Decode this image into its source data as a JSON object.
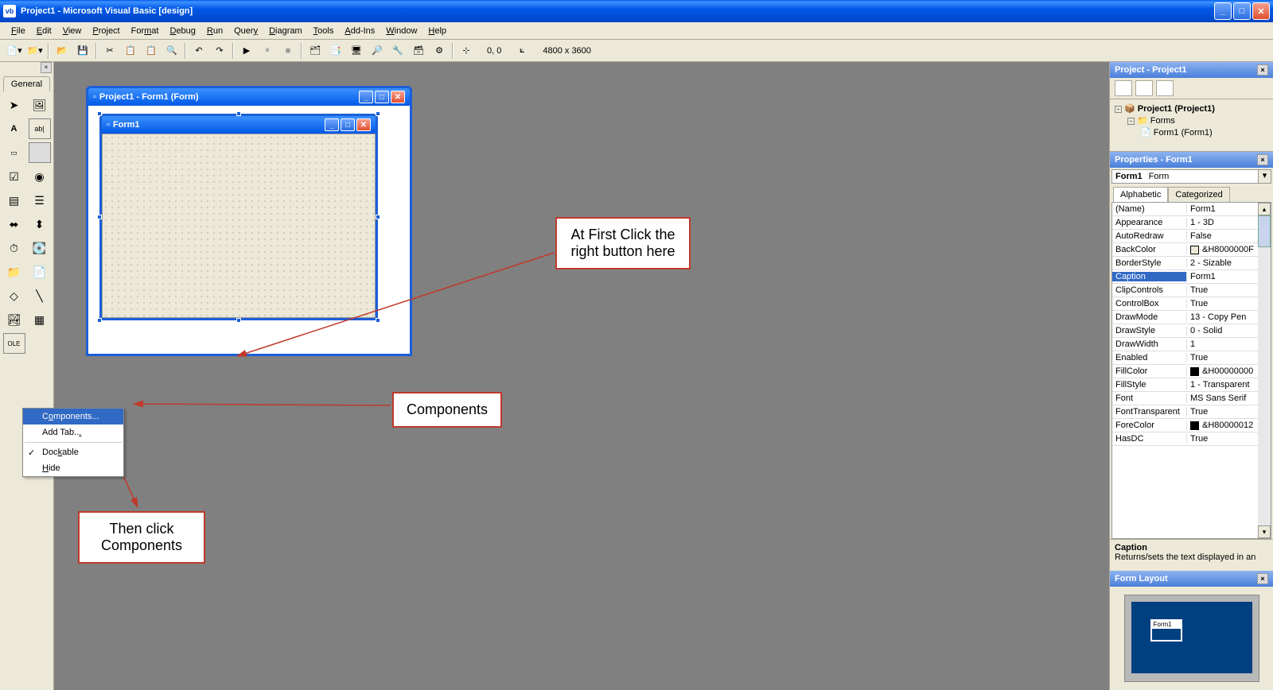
{
  "title": "Project1 - Microsoft Visual Basic [design]",
  "menu": [
    "File",
    "Edit",
    "View",
    "Project",
    "Format",
    "Debug",
    "Run",
    "Query",
    "Diagram",
    "Tools",
    "Add-Ins",
    "Window",
    "Help"
  ],
  "menuUnderline": [
    0,
    0,
    0,
    0,
    3,
    0,
    0,
    4,
    0,
    0,
    0,
    0,
    0
  ],
  "coords": "0, 0",
  "dims": "4800 x 3600",
  "toolbox": {
    "tab": "General"
  },
  "formDesigner": {
    "title": "Project1 - Form1 (Form)",
    "innerTitle": "Form1"
  },
  "contextMenu": {
    "items": [
      "Components...",
      "Add Tab...",
      "Dockable",
      "Hide"
    ],
    "itemsUnderline": [
      1,
      9,
      3,
      0
    ]
  },
  "callouts": {
    "first": "At First Click the right button here",
    "comp": "Components",
    "then": "Then click Components"
  },
  "projectPanel": {
    "title": "Project - Project1",
    "root": "Project1 (Project1)",
    "folder": "Forms",
    "form": "Form1 (Form1)"
  },
  "propsPanel": {
    "title": "Properties - Form1",
    "objName": "Form1",
    "objType": "Form",
    "tabs": [
      "Alphabetic",
      "Categorized"
    ],
    "rows": [
      {
        "k": "(Name)",
        "v": "Form1"
      },
      {
        "k": "Appearance",
        "v": "1 - 3D"
      },
      {
        "k": "AutoRedraw",
        "v": "False"
      },
      {
        "k": "BackColor",
        "v": "&H8000000F",
        "swatch": "#ece9d8"
      },
      {
        "k": "BorderStyle",
        "v": "2 - Sizable"
      },
      {
        "k": "Caption",
        "v": "Form1",
        "selected": true
      },
      {
        "k": "ClipControls",
        "v": "True"
      },
      {
        "k": "ControlBox",
        "v": "True"
      },
      {
        "k": "DrawMode",
        "v": "13 - Copy Pen"
      },
      {
        "k": "DrawStyle",
        "v": "0 - Solid"
      },
      {
        "k": "DrawWidth",
        "v": "1"
      },
      {
        "k": "Enabled",
        "v": "True"
      },
      {
        "k": "FillColor",
        "v": "&H00000000",
        "swatch": "#000"
      },
      {
        "k": "FillStyle",
        "v": "1 - Transparent"
      },
      {
        "k": "Font",
        "v": "MS Sans Serif"
      },
      {
        "k": "FontTransparent",
        "v": "True"
      },
      {
        "k": "ForeColor",
        "v": "&H80000012",
        "swatch": "#000"
      },
      {
        "k": "HasDC",
        "v": "True"
      }
    ],
    "descTitle": "Caption",
    "descText": "Returns/sets the text displayed in an"
  },
  "formLayout": {
    "title": "Form Layout",
    "formLabel": "Form1"
  }
}
